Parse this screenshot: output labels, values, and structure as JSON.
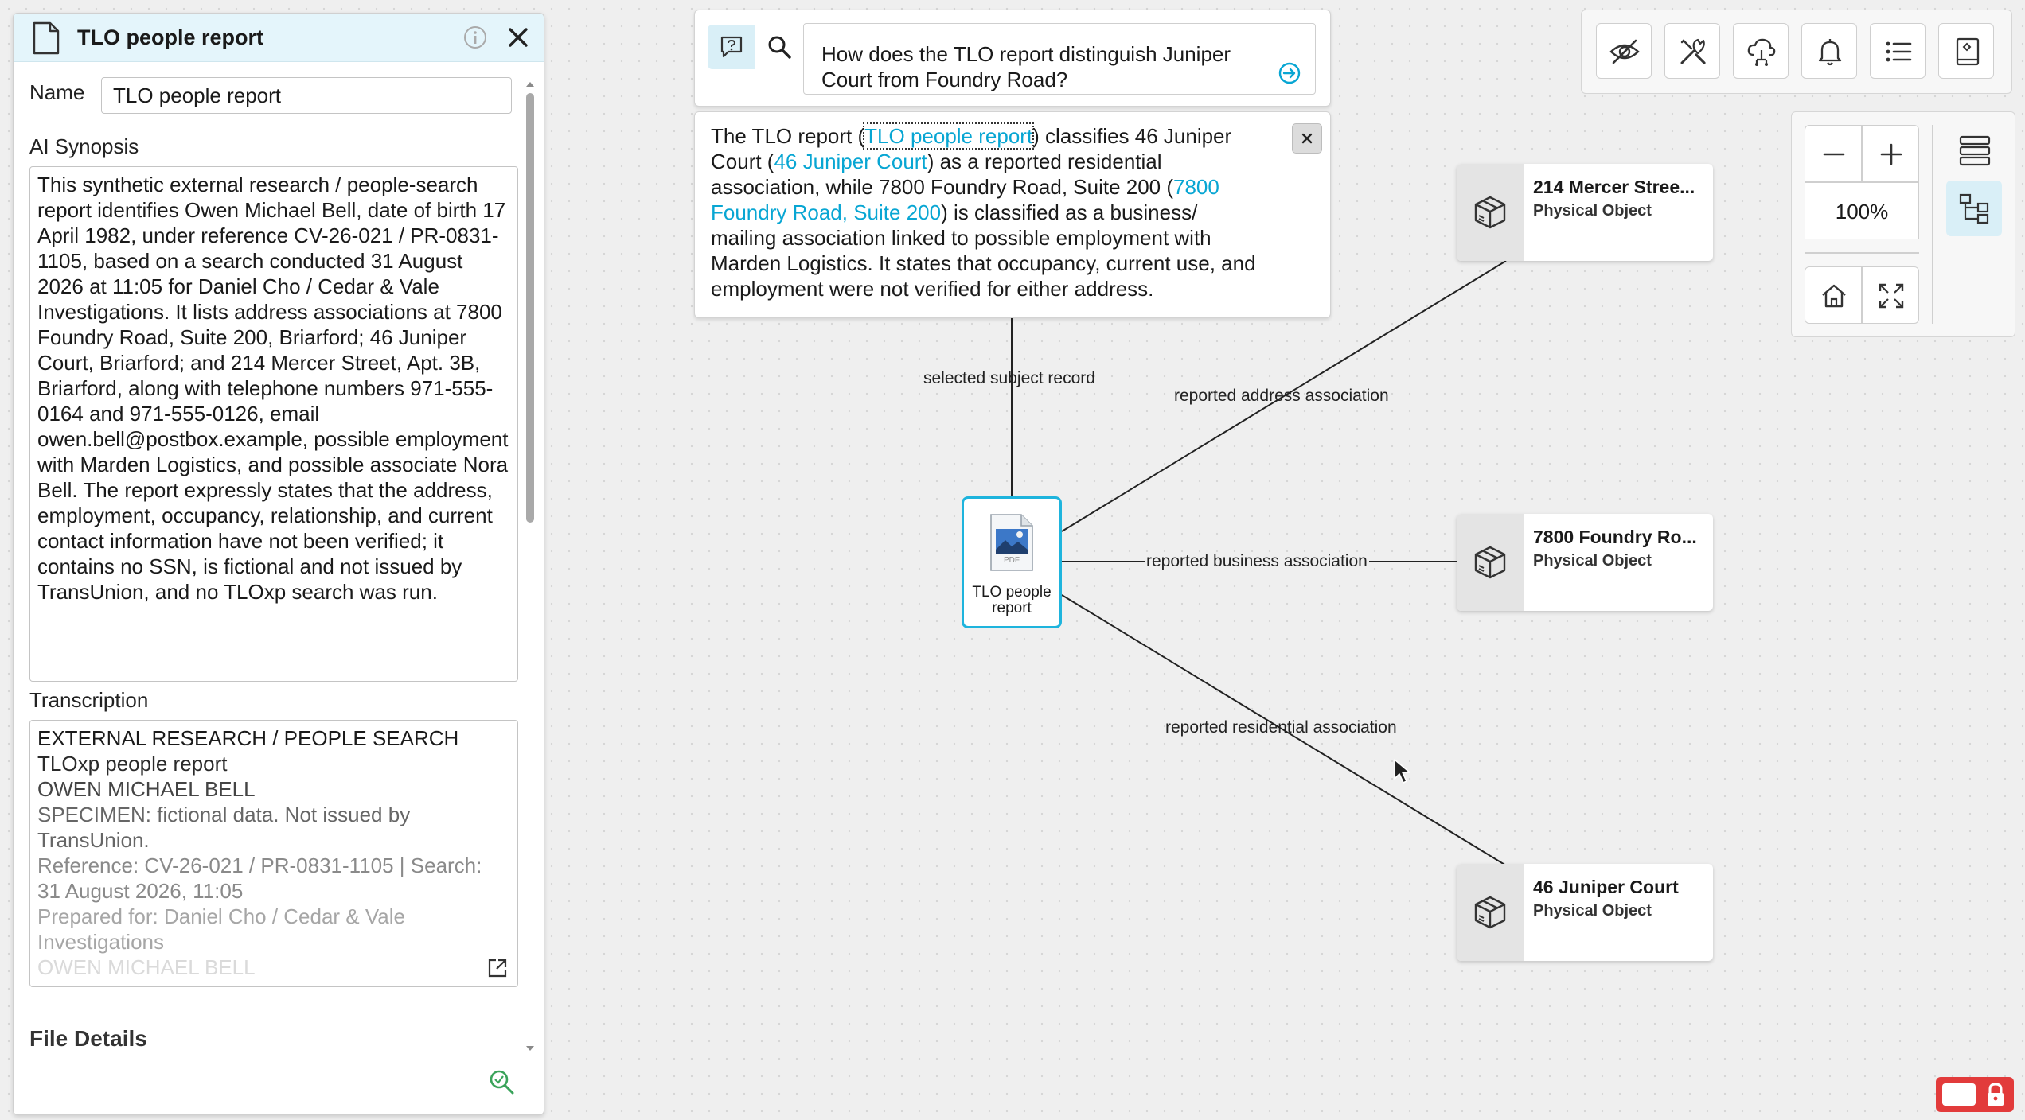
{
  "panel": {
    "title": "TLO people report",
    "name_label": "Name",
    "name_value": "TLO people report",
    "synopsis_label": "AI Synopsis",
    "synopsis": "This synthetic external research / people-search report identifies Owen Michael Bell, date of birth 17 April 1982, under reference CV-26-021 / PR-0831-1105, based on a search conducted 31 August 2026 at 11:05 for Daniel Cho / Cedar & Vale Investigations. It lists address associations at 7800 Foundry Road, Suite 200, Briarford; 46 Juniper Court, Briarford; and 214 Mercer Street, Apt. 3B, Briarford, along with telephone numbers 971-555-0164 and 971-555-0126, email owen.bell@postbox.example, possible employment with Marden Logistics, and possible associate Nora Bell. The report expressly states that the address, employment, occupancy, relationship, and current contact information have not been verified; it contains no SSN, is fictional and not issued by TransUnion, and no TLOxp search was run.",
    "transcription_label": "Transcription",
    "transcription_lines": [
      "EXTERNAL RESEARCH / PEOPLE SEARCH",
      "TLOxp people report",
      "OWEN MICHAEL BELL",
      "SPECIMEN: fictional data. Not issued by TransUnion.",
      "Reference: CV-26-021 / PR-0831-1105 | Search: 31 August 2026, 11:05",
      "Prepared for: Daniel Cho / Cedar & Vale Investigations",
      "OWEN MICHAEL BELL"
    ],
    "file_details_label": "File Details"
  },
  "search": {
    "query": "How does the TLO report distinguish Juniper Court from Foundry Road?"
  },
  "answer": {
    "p1": "The TLO report (",
    "link1": "TLO people report",
    "p2": ") classifies 46 Juniper Court (",
    "link2": "46 Juniper Court",
    "p3": ") as a reported residential association, while 7800 Foundry Road, Suite 200 (",
    "link3": "7800 Foundry Road, Suite 200",
    "p4": ") is classified as a business/ mailing association linked to possible employment with Marden Logistics. It states that occupancy, current use, and employment were not verified for either address."
  },
  "zoom": {
    "level": "100%"
  },
  "graph": {
    "doc_node": {
      "label": "TLO people report",
      "icon": "pdf-file-icon",
      "file_ext": "PDF"
    },
    "edges": {
      "subject": "selected subject record",
      "mercer": "reported address association",
      "foundry": "reported business association",
      "juniper": "reported residential association"
    },
    "nodes": [
      {
        "title": "214 Mercer Stree...",
        "type": "Physical Object",
        "icon": "package-icon"
      },
      {
        "title": "7800 Foundry Ro...",
        "type": "Physical Object",
        "icon": "package-icon"
      },
      {
        "title": "46 Juniper Court",
        "type": "Physical Object",
        "icon": "package-icon"
      }
    ]
  },
  "toolbar_icons": [
    "eye-off-icon",
    "tools-icon",
    "cloud-network-icon",
    "bell-icon",
    "list-icon",
    "notebook-icon"
  ],
  "colors": {
    "accent": "#1eb4dd",
    "header_bg": "#e4f5fb",
    "link": "#08a6d3",
    "lock": "#e23b3b"
  }
}
